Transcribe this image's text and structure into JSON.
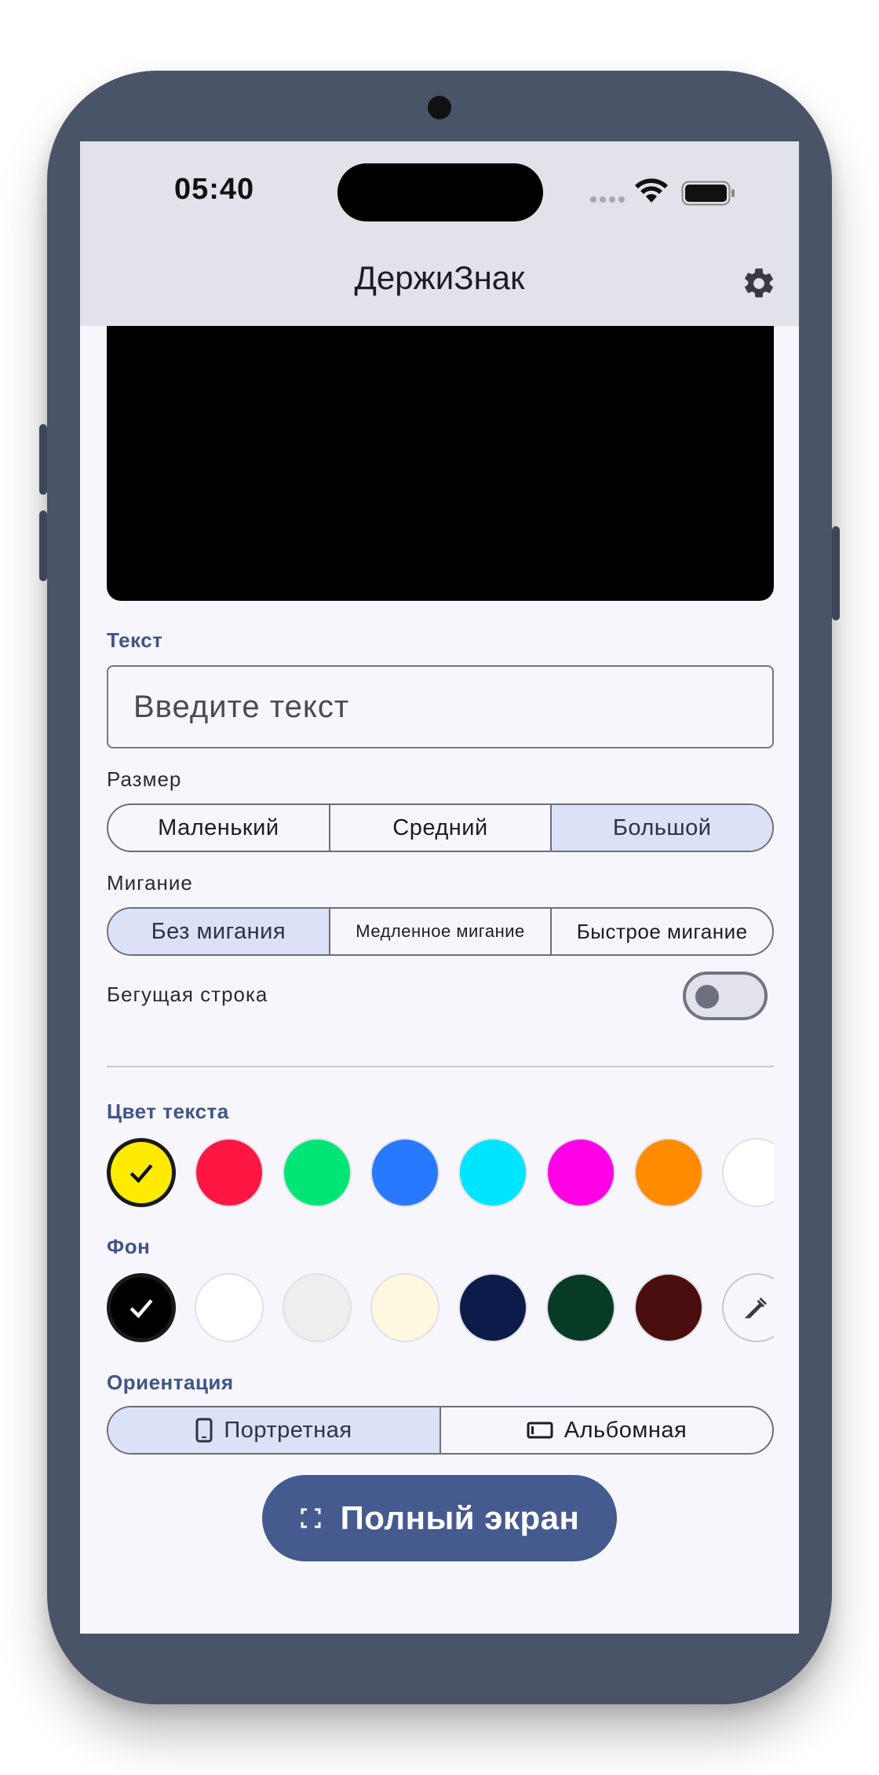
{
  "status_bar": {
    "time": "05:40"
  },
  "app_bar": {
    "title": "ДержиЗнак",
    "settings_icon": "gear-icon"
  },
  "text_section": {
    "label": "Текст",
    "input_value": "",
    "input_placeholder": "Введите текст"
  },
  "size_section": {
    "label": "Размер",
    "options": [
      "Маленький",
      "Средний",
      "Большой"
    ],
    "selected": "Большой"
  },
  "blink_section": {
    "label": "Мигание",
    "options": [
      "Без мигания",
      "Медленное мигание",
      "Быстрое мигание"
    ],
    "selected": "Без мигания"
  },
  "marquee": {
    "label": "Бегущая строка",
    "enabled": false
  },
  "text_color_section": {
    "label": "Цвет текста",
    "colors": [
      "#ffeb00",
      "#ff1744",
      "#00e676",
      "#2979ff",
      "#00e5ff",
      "#ff00e6",
      "#ff8c00",
      "#ffffff"
    ],
    "selected_index": 0
  },
  "background_section": {
    "label": "Фон",
    "colors": [
      "#000000",
      "#ffffff",
      "#eeeeee",
      "#fff8e1",
      "#0d1b4b",
      "#073b26",
      "#4a0e0e"
    ],
    "custom_picker_icon": "eyedropper-icon",
    "selected_index": 0
  },
  "orientation_section": {
    "label": "Ориентация",
    "options": [
      "Портретная",
      "Альбомная"
    ],
    "selected": "Портретная",
    "icons": [
      "phone-portrait-icon",
      "phone-landscape-icon"
    ]
  },
  "fullscreen_button": {
    "label": "Полный экран",
    "icon": "fullscreen-icon"
  },
  "colors": {
    "accent": "#455a8e",
    "selected_segment": "#dbe1f6",
    "app_bar": "#e2e2ea",
    "device_frame": "#4a5468"
  }
}
